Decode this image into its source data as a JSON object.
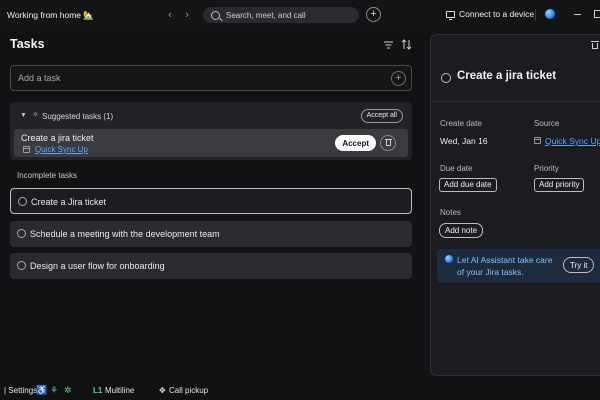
{
  "titlebar": {
    "status": "Working from home 🏡",
    "search_placeholder": "Search, meet, and call",
    "connect_label": "Connect to a device"
  },
  "tasks": {
    "title": "Tasks",
    "add_placeholder": "Add a task",
    "suggested": {
      "title": "Suggested tasks (1)",
      "accept_all": "Accept all",
      "item": {
        "title": "Create a jira ticket",
        "source": "Quick Sync Up",
        "accept": "Accept"
      }
    },
    "incomplete_label": "Incomplete tasks",
    "items": [
      {
        "label": "Create a Jira ticket",
        "selected": true
      },
      {
        "label": "Schedule a meeting with the development team",
        "selected": false
      },
      {
        "label": "Design a user flow for onboarding",
        "selected": false
      }
    ]
  },
  "detail": {
    "title": "Create a jira ticket",
    "create_date_label": "Create date",
    "create_date_value": "Wed, Jan 16",
    "source_label": "Source",
    "source_value": "Quick Sync Up",
    "due_date_label": "Due date",
    "add_due_date": "Add due date",
    "priority_label": "Priority",
    "add_priority": "Add priority",
    "notes_label": "Notes",
    "add_note": "Add note",
    "ai_text": "Let AI Assistant take care of your Jira tasks.",
    "try_it": "Try it"
  },
  "bottombar": {
    "settings": "| Settings",
    "line_marker": "L1",
    "line_label": "Multiline",
    "pickup_label": "Call pickup"
  },
  "icons": {
    "status_emoji": "house-icon",
    "ai_assistant": "ai-assistant-icon"
  },
  "colors": {
    "accent_link": "#5aa7ff",
    "ai_card_bg": "#1d2b3d",
    "status_green": "#5ad07a"
  }
}
